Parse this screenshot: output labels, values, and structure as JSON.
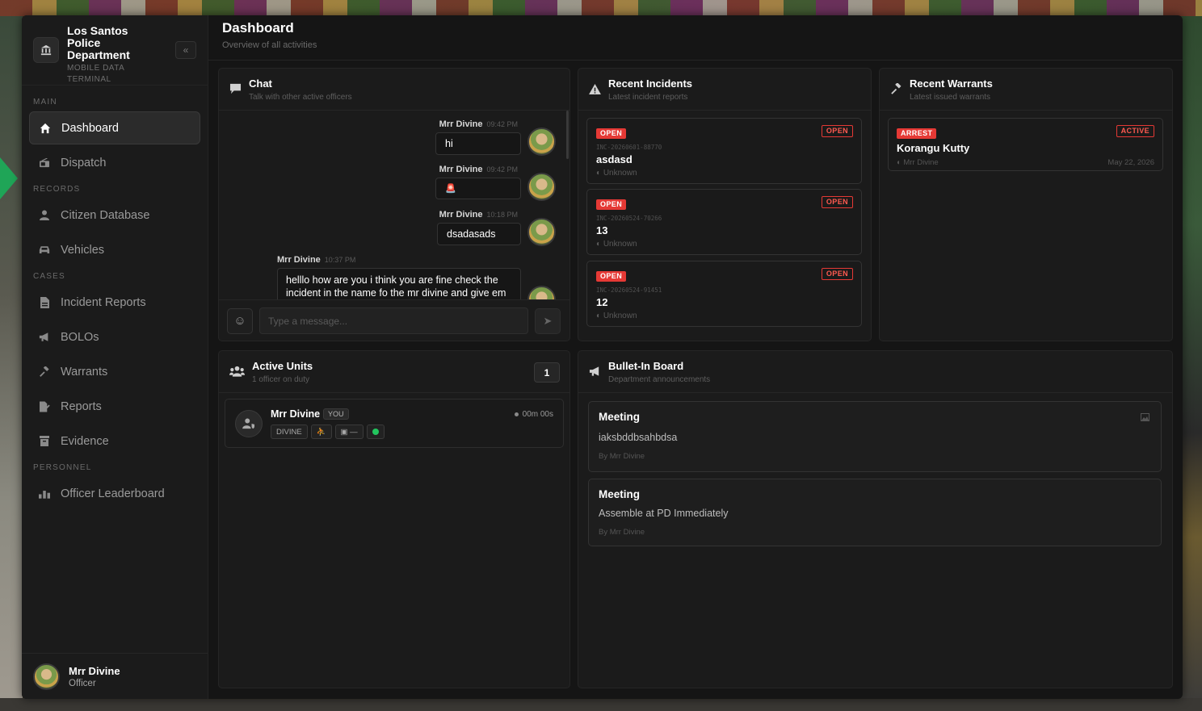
{
  "brand": {
    "title": "Los Santos Police Department",
    "subtitle": "MOBILE DATA TERMINAL",
    "icon": "building-columns-icon",
    "collapse_label": "«"
  },
  "nav": {
    "sections": {
      "main": "MAIN",
      "records": "RECORDS",
      "cases": "CASES",
      "personnel": "PERSONNEL"
    },
    "items": {
      "dashboard": "Dashboard",
      "dispatch": "Dispatch",
      "citizen_database": "Citizen Database",
      "vehicles": "Vehicles",
      "incident_reports": "Incident Reports",
      "bolos": "BOLOs",
      "warrants": "Warrants",
      "reports": "Reports",
      "evidence": "Evidence",
      "officer_leaderboard": "Officer Leaderboard"
    },
    "active": "dashboard"
  },
  "user": {
    "name": "Mrr Divine",
    "role": "Officer"
  },
  "header": {
    "title": "Dashboard",
    "subtitle": "Overview of all activities"
  },
  "chat": {
    "title": "Chat",
    "subtitle": "Talk with other active officers",
    "messages": [
      {
        "author": "Mrr Divine",
        "time": "09:42 PM",
        "text": "hi"
      },
      {
        "author": "Mrr Divine",
        "time": "09:42 PM",
        "text": "🚨"
      },
      {
        "author": "Mrr Divine",
        "time": "10:18 PM",
        "text": "dsadasads"
      },
      {
        "author": "Mrr Divine",
        "time": "10:37 PM",
        "text_line1": "helllo how are you i think you are fine check the",
        "text_line2": "incident in the name fo the mr divine and give em"
      }
    ],
    "input_placeholder": "Type a message...",
    "emoji_icon": "☺",
    "send_icon": "➤"
  },
  "incidents": {
    "title": "Recent Incidents",
    "subtitle": "Latest incident reports",
    "items": [
      {
        "badge": "OPEN",
        "status": "OPEN",
        "id": "INC-20260601-88770",
        "title": "asdasd",
        "location": "Unknown"
      },
      {
        "badge": "OPEN",
        "status": "OPEN",
        "id": "INC-20260524-70266",
        "title": "13",
        "location": "Unknown"
      },
      {
        "badge": "OPEN",
        "status": "OPEN",
        "id": "INC-20260524-91451",
        "title": "12",
        "location": "Unknown"
      }
    ]
  },
  "warrants": {
    "title": "Recent Warrants",
    "subtitle": "Latest issued warrants",
    "items": [
      {
        "badge": "ARREST",
        "status": "ACTIVE",
        "name": "Korangu Kutty",
        "officer": "Mrr Divine",
        "date": "May 22, 2026"
      }
    ]
  },
  "units": {
    "title": "Active Units",
    "subtitle": "1 officer on duty",
    "count": "1",
    "items": [
      {
        "name": "Mrr Divine",
        "you": "YOU",
        "callsign": "DIVINE",
        "radio": "—",
        "timer": "00m 00s"
      }
    ]
  },
  "bulletin": {
    "title": "Bullet-In Board",
    "subtitle": "Department announcements",
    "items": [
      {
        "title": "Meeting",
        "body": "iaksbddbsahbdsa",
        "by": "By Mrr Divine"
      },
      {
        "title": "Meeting",
        "body": "Assemble at PD Immediately",
        "by": "By Mrr Divine"
      }
    ]
  },
  "colors": {
    "accent_red": "#e53935",
    "online_green": "#22c55e",
    "panel_bg": "#1b1b1b",
    "app_bg": "#151515"
  }
}
